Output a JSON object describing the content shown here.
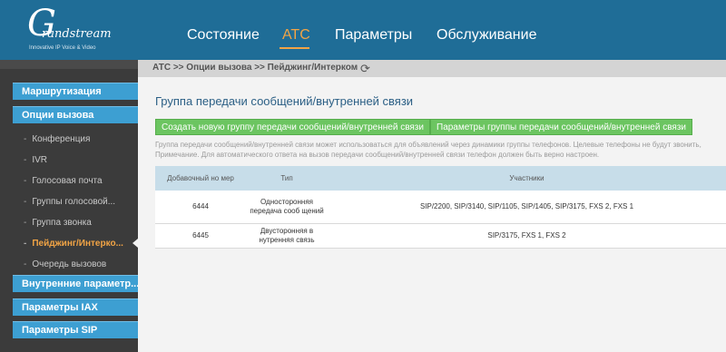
{
  "logo": {
    "mark": "G",
    "word": "randstream",
    "tagline": "Innovative IP Voice & Video"
  },
  "nav": {
    "items": [
      "Состояние",
      "АТС",
      "Параметры",
      "Обслуживание"
    ],
    "active": "АТС"
  },
  "sidebar": {
    "sections_top": [
      "Маршрутизация",
      "Опции вызова"
    ],
    "items": [
      "Конференция",
      "IVR",
      "Голосовая почта",
      "Группы голосовой...",
      "Группа звонка",
      "Пейджинг/Интерко...",
      "Очередь вызовов"
    ],
    "active_item": "Пейджинг/Интерко...",
    "sections_bottom": [
      "Внутренние параметр...",
      "Параметры IAX",
      "Параметры SIP"
    ]
  },
  "breadcrumb": "АТС >> Опции вызова >> Пейджинг/Интерком",
  "page": {
    "title": "Группа передачи сообщений/внутренней связи",
    "buttons": {
      "create": "Создать новую группу передачи сообщений/внутренней связи",
      "settings": "Параметры группы передачи сообщений/внутренней связи"
    },
    "note_line1": "Группа передачи сообщений/внутренней связи может использоваться для объявлений через динамики группы телефонов. Целевые телефоны не будут звонить,",
    "note_line2": "Примечание. Для автоматического ответа на вызов передачи сообщений/внутренней связи телефон должен быть верно настроен."
  },
  "table": {
    "headers": {
      "ext": "Добавочный но мер",
      "type": "Тип",
      "members": "Участники"
    },
    "rows": [
      {
        "ext": "6444",
        "type": "Односторонняя передача сооб щений",
        "members": "SIP/2200, SIP/3140, SIP/1105, SIP/1405, SIP/3175, FXS 2, FXS 1"
      },
      {
        "ext": "6445",
        "type": "Двусторонняя в нутренняя связь",
        "members": "SIP/3175, FXS 1, FXS 2"
      }
    ]
  },
  "colors": {
    "header_bg": "#1f6d97",
    "accent": "#f2a445",
    "sidebar_section": "#3d9fd2",
    "button_green": "#6cc561"
  }
}
